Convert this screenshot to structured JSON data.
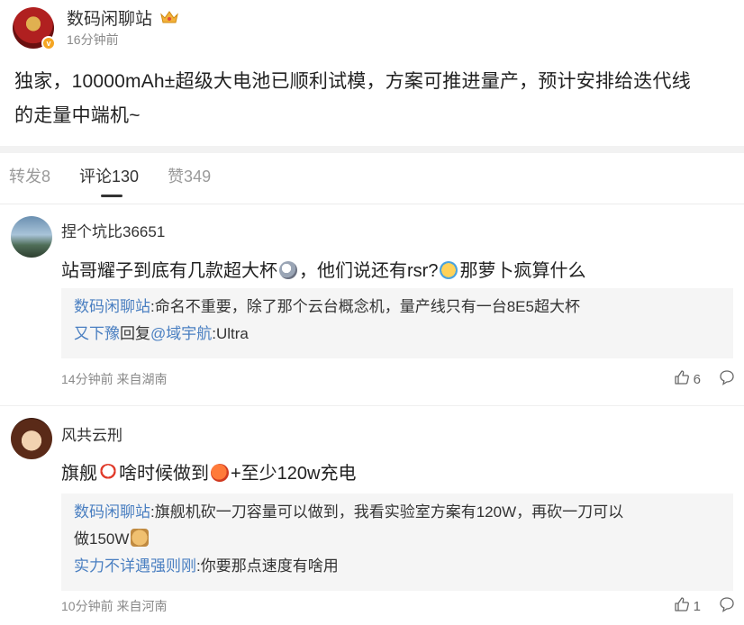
{
  "post": {
    "author": "数码闲聊站",
    "time": "16分钟前",
    "body_line1": "独家，10000mAh±超级大电池已顺利试模，方案可推进量产，预计安排给迭代线",
    "body_line2": "的走量中端机~"
  },
  "tabs": [
    {
      "label": "转发8",
      "active": false
    },
    {
      "label": "评论130",
      "active": true
    },
    {
      "label": "赞349",
      "active": false
    }
  ],
  "comments": [
    {
      "name": "捏个坑比36651",
      "text_part1": "站哥耀子到底有几款超大杯",
      "text_part2": "，他们说还有rsr?",
      "text_part3": "那萝卜疯算什么",
      "reply1_author": "数码闲聊站",
      "reply1_text": ":命名不重要，除了那个云台概念机，量产线只有一台8E5超大杯",
      "reply2_author": "又下豫",
      "reply2_mid": "回复",
      "reply2_target": "@域宇航",
      "reply2_text": ":Ultra",
      "foot": "14分钟前 来自湖南",
      "likes": "6"
    },
    {
      "name": "风共云刑",
      "text_part1": "旗舰",
      "text_part2": "啥时候做到",
      "text_part3": "+至少120w充电",
      "reply1_author": "数码闲聊站",
      "reply1_text": ":旗舰机砍一刀容量可以做到，我看实验室方案有120W，再砍一刀可以",
      "reply1_text2": "做150W",
      "reply2_author": "实力不详遇强则刚",
      "reply2_text": ":你要那点速度有啥用",
      "foot": "10分钟前 来自河南",
      "likes": "1"
    }
  ],
  "icons": {
    "crown": "crown-icon",
    "like": "thumbs-up-icon",
    "comment": "comment-bubble-icon"
  },
  "colors": {
    "link": "#4a7fc1",
    "badge": "#f5a623"
  }
}
